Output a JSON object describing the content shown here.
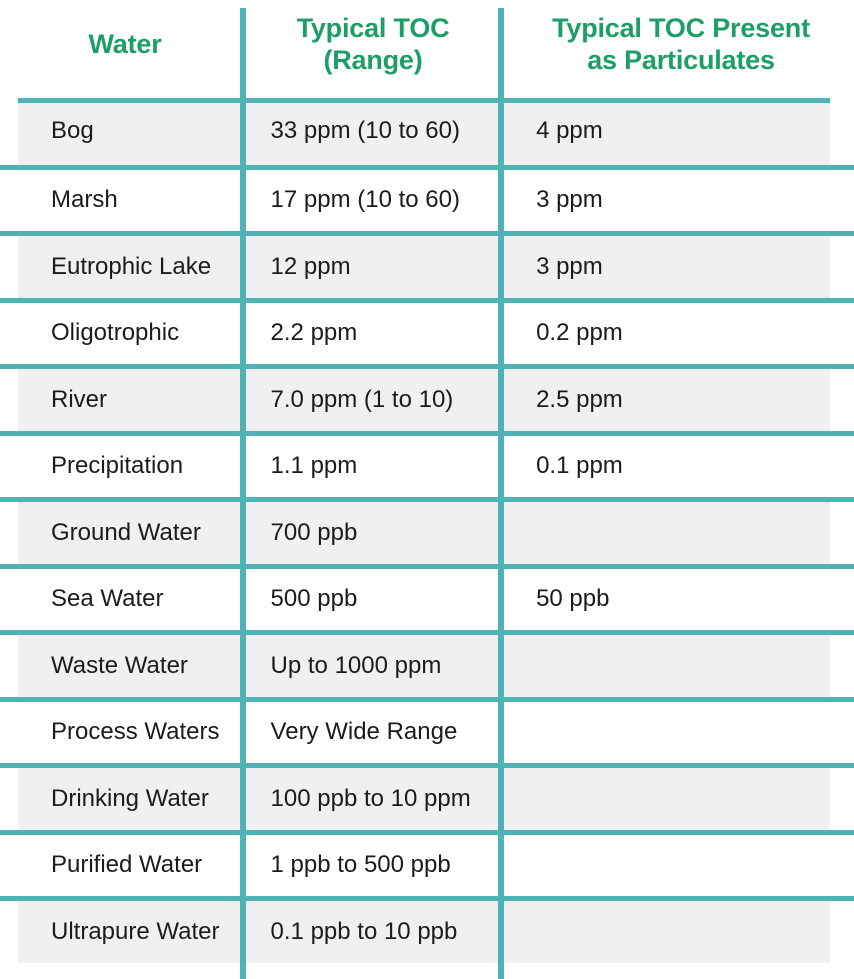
{
  "table": {
    "columns": [
      {
        "id": "water",
        "label": "Water"
      },
      {
        "id": "typical_toc",
        "label": "Typical TOC\n(Range)",
        "label_line1": "Typical TOC",
        "label_line2": "(Range)"
      },
      {
        "id": "particulates",
        "label": "Typical TOC Present\nas Particulates",
        "label_line1": "Typical TOC Present",
        "label_line2": "as Particulates"
      }
    ],
    "rows": [
      {
        "water": "Bog",
        "typical_toc": "33 ppm (10 to 60)",
        "particulates": "4 ppm"
      },
      {
        "water": "Marsh",
        "typical_toc": "17 ppm (10 to 60)",
        "particulates": "3 ppm"
      },
      {
        "water": "Eutrophic Lake",
        "typical_toc": "12 ppm",
        "particulates": "3 ppm"
      },
      {
        "water": "Oligotrophic",
        "typical_toc": "2.2 ppm",
        "particulates": "0.2 ppm"
      },
      {
        "water": "River",
        "typical_toc": "7.0 ppm (1 to 10)",
        "particulates": "2.5 ppm"
      },
      {
        "water": "Precipitation",
        "typical_toc": "1.1 ppm",
        "particulates": "0.1 ppm"
      },
      {
        "water": "Ground Water",
        "typical_toc": "700 ppb",
        "particulates": ""
      },
      {
        "water": "Sea Water",
        "typical_toc": "500 ppb",
        "particulates": "50 ppb"
      },
      {
        "water": "Waste Water",
        "typical_toc": "Up to 1000 ppm",
        "particulates": ""
      },
      {
        "water": "Process Waters",
        "typical_toc": "Very Wide Range",
        "particulates": ""
      },
      {
        "water": "Drinking Water",
        "typical_toc": "100 ppb to 10 ppm",
        "particulates": ""
      },
      {
        "water": "Purified Water",
        "typical_toc": "1 ppb to 500 ppb",
        "particulates": ""
      },
      {
        "water": "Ultrapure Water",
        "typical_toc": "0.1 ppb to 10 ppb",
        "particulates": ""
      }
    ],
    "colors": {
      "header_text": "#1d9e68",
      "rule": "#4fb3b5",
      "row_shaded_bg": "#f0f0f0",
      "row_plain_bg": "#ffffff",
      "body_text": "#1b1b1b"
    }
  }
}
